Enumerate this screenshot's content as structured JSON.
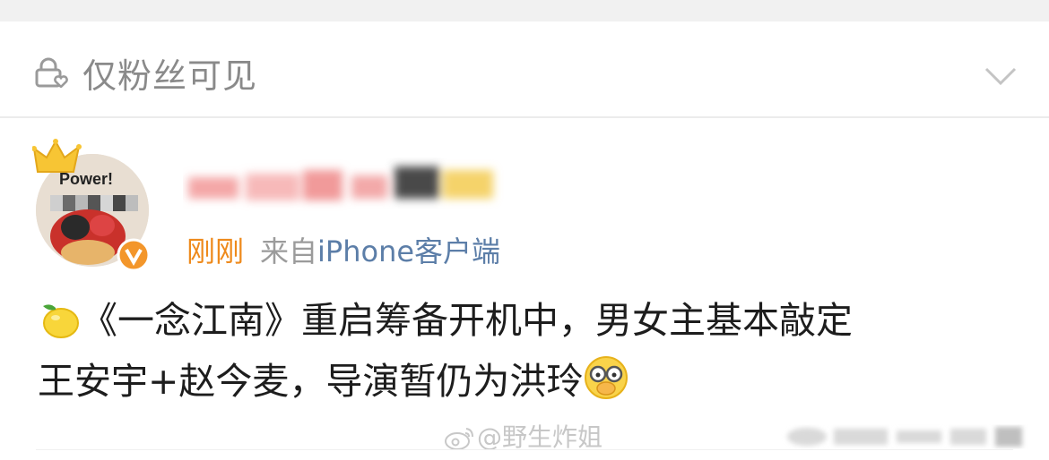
{
  "header": {
    "visibility_label": "仅粉丝可见",
    "lock_icon": "lock-heart-icon",
    "expand_icon": "chevron-down-icon"
  },
  "post": {
    "author": {
      "avatar_badge_text": "Power!",
      "verified_icon": "verified-v-icon",
      "crown_icon": "crown-icon"
    },
    "time": "刚刚",
    "source_prefix": "来自",
    "source_name": "iPhone客户端",
    "text_line1": "《一念江南》重启筹备开机中，男女主基本敲定",
    "text_line2": "王安宇+赵今麦，导演暂仍为洪玲",
    "lead_emoji": "lemon-icon",
    "trail_emoji": "covering-eyes-face-icon"
  },
  "watermark": {
    "text": "@野生炸姐",
    "logo_icon": "weibo-logo-icon"
  },
  "colors": {
    "time": "#ee8a1c",
    "source": "#5c7ea8",
    "muted": "#9b9b9b",
    "text": "#1d1d1d"
  }
}
